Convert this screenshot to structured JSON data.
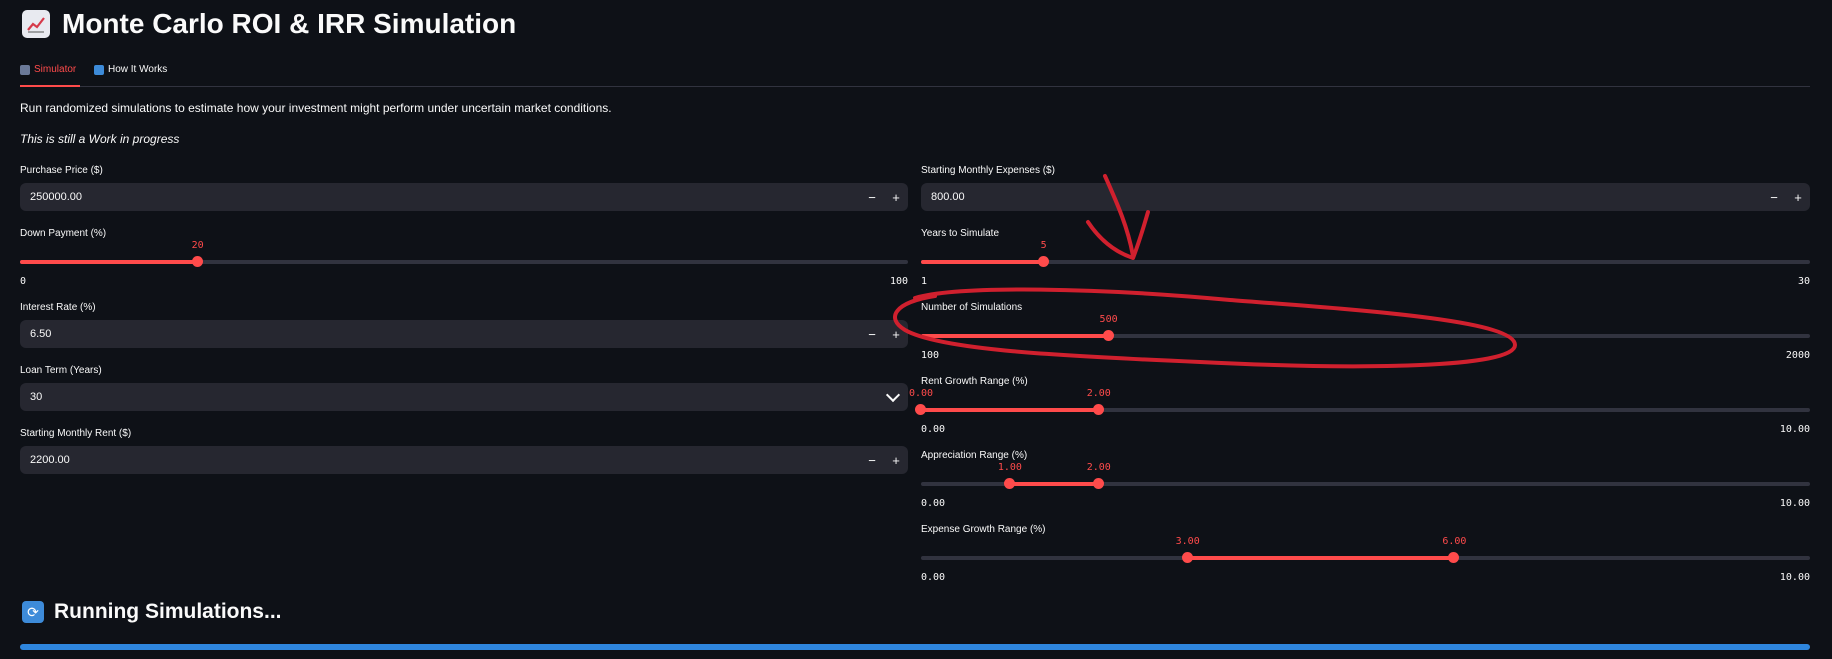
{
  "title": "Monte Carlo ROI & IRR Simulation",
  "tabs": [
    {
      "label": "Simulator",
      "icon": "bar-chart-icon",
      "active": true
    },
    {
      "label": "How It Works",
      "icon": "info-icon",
      "active": false
    }
  ],
  "intro": "Run randomized simulations to estimate how your investment might perform under uncertain market conditions.",
  "wip_note": "This is still a Work in progress",
  "left": {
    "purchase_price": {
      "label": "Purchase Price ($)",
      "value": "250000.00"
    },
    "down_payment": {
      "label": "Down Payment (%)",
      "value": "20",
      "min": "0",
      "max": "100",
      "level": 0.2
    },
    "interest_rate": {
      "label": "Interest Rate (%)",
      "value": "6.50"
    },
    "loan_term": {
      "label": "Loan Term (Years)",
      "value": "30"
    },
    "monthly_rent": {
      "label": "Starting Monthly Rent ($)",
      "value": "2200.00"
    }
  },
  "right": {
    "monthly_expenses": {
      "label": "Starting Monthly Expenses ($)",
      "value": "800.00"
    },
    "years": {
      "label": "Years to Simulate",
      "value": "5",
      "min": "1",
      "max": "30",
      "level": 0.138
    },
    "simulations": {
      "label": "Number of Simulations",
      "value": "500",
      "min": "100",
      "max": "2000",
      "level": 0.211
    },
    "rent_growth": {
      "label": "Rent Growth Range (%)",
      "low": "0.00",
      "high": "2.00",
      "min": "0.00",
      "max": "10.00",
      "low_level": 0.0,
      "high_level": 0.2
    },
    "appreciation": {
      "label": "Appreciation Range (%)",
      "low": "1.00",
      "high": "2.00",
      "min": "0.00",
      "max": "10.00",
      "low_level": 0.1,
      "high_level": 0.2
    },
    "expense_growth": {
      "label": "Expense Growth Range (%)",
      "low": "3.00",
      "high": "6.00",
      "min": "0.00",
      "max": "10.00",
      "low_level": 0.3,
      "high_level": 0.6
    }
  },
  "running": {
    "label": "Running Simulations...",
    "icon": "refresh-icon",
    "progress": 1.0
  },
  "buttons": {
    "minus": "−",
    "plus": "+"
  },
  "colors": {
    "accent": "#ff4b4b",
    "progress": "#2e86de",
    "background": "#0e1117",
    "annotation": "#d0202e"
  }
}
